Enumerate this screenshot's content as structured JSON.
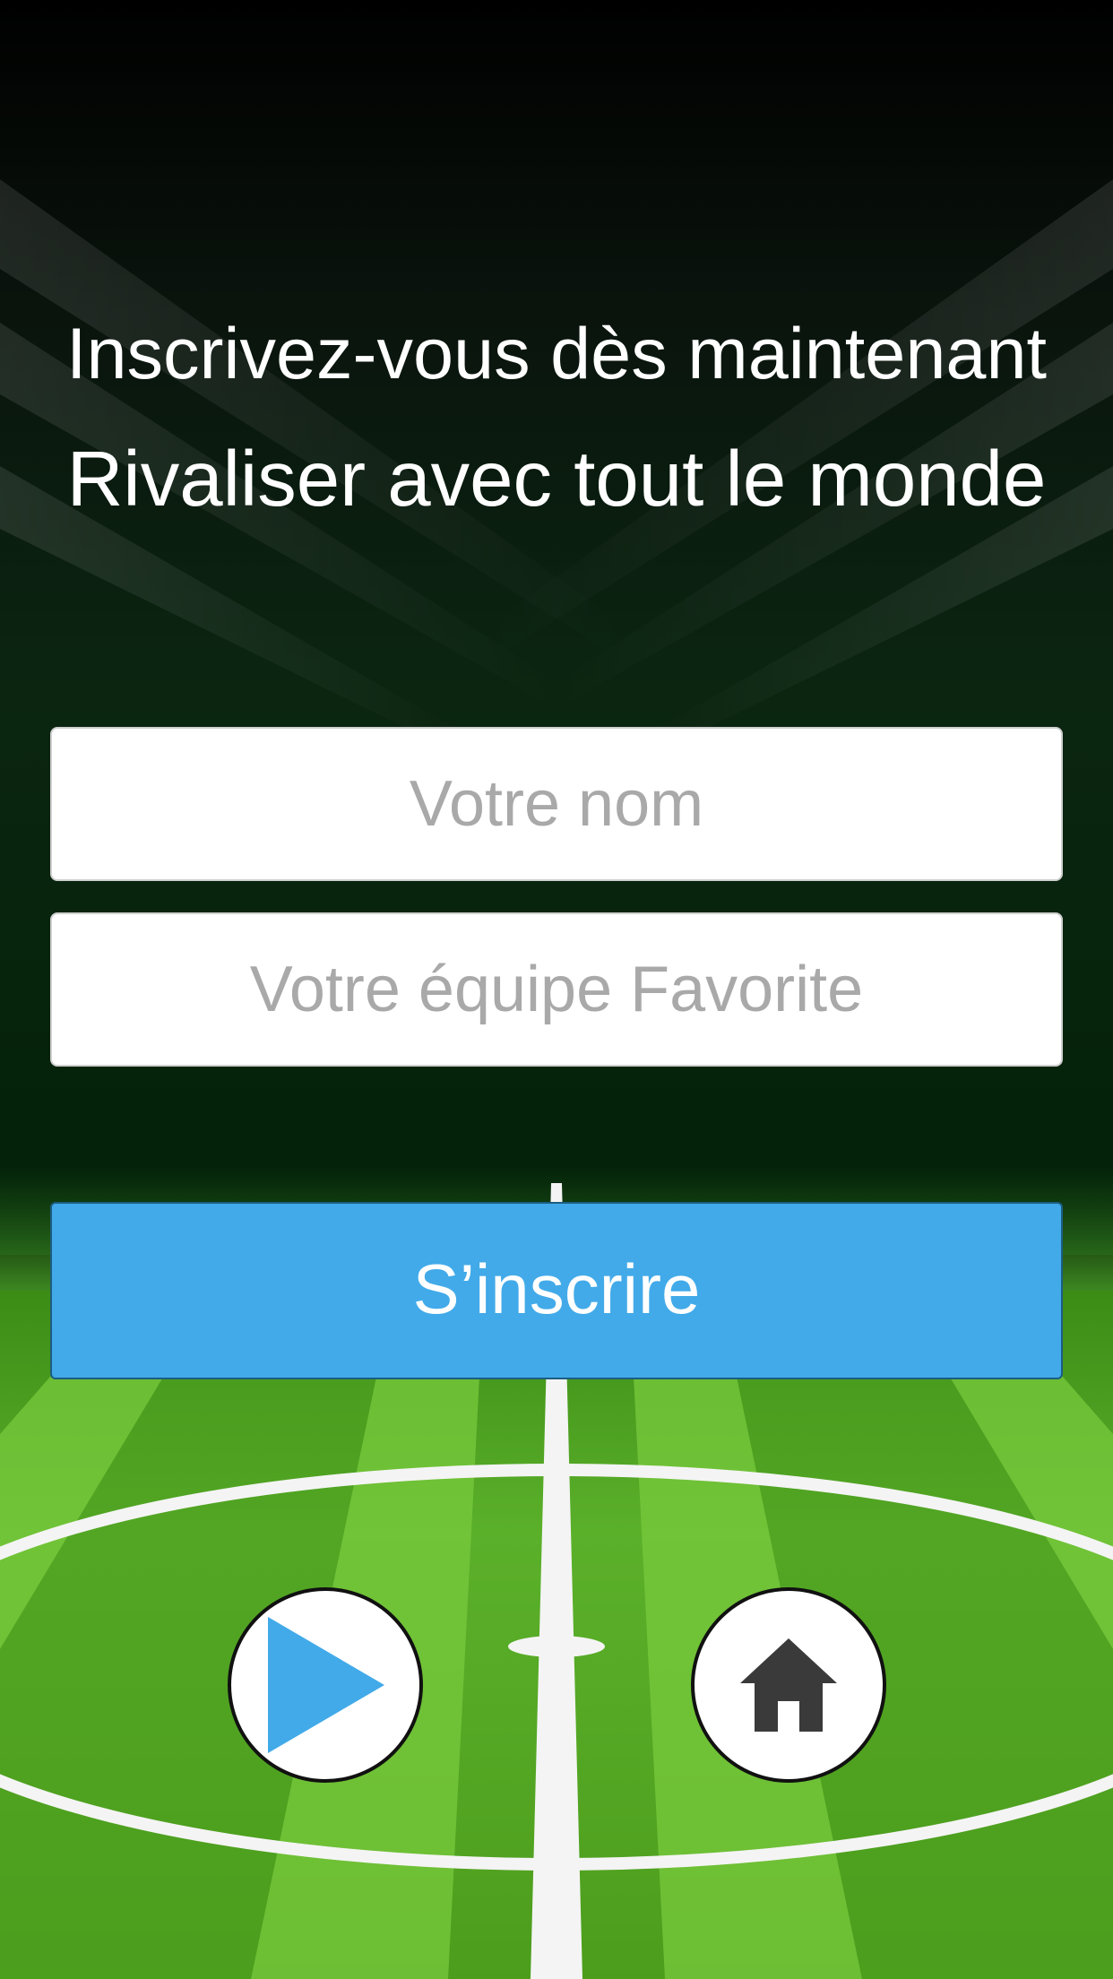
{
  "header": {
    "line1": "Inscrivez-vous dès maintenant",
    "line2": "Rivaliser avec tout le monde"
  },
  "form": {
    "name_placeholder": "Votre nom",
    "name_value": "",
    "team_placeholder": "Votre équipe Favorite",
    "team_value": "",
    "submit_label": "S’inscrire"
  },
  "controls": {
    "play_icon": "play-icon",
    "home_icon": "home-icon"
  },
  "colors": {
    "accent": "#42aae9",
    "pitch_light": "#6dbf34",
    "pitch_dark": "#3f8f16",
    "icon_dark": "#3a3a3a"
  }
}
